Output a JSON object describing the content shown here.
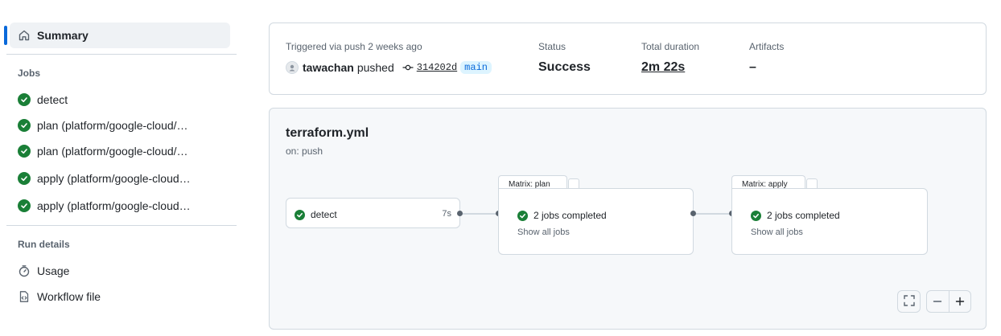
{
  "sidebar": {
    "summary_label": "Summary",
    "jobs_heading": "Jobs",
    "jobs": [
      {
        "label": "detect"
      },
      {
        "label": "plan (platform/google-cloud/…"
      },
      {
        "label": "plan (platform/google-cloud/…"
      },
      {
        "label": "apply (platform/google-cloud…"
      },
      {
        "label": "apply (platform/google-cloud…"
      }
    ],
    "run_details_heading": "Run details",
    "usage_label": "Usage",
    "workflow_file_label": "Workflow file"
  },
  "summary": {
    "trigger_text": "Triggered via push 2 weeks ago",
    "actor": "tawachan",
    "action": "pushed",
    "commit_sha": "314202d",
    "branch": "main",
    "status_label": "Status",
    "status_value": "Success",
    "duration_label": "Total duration",
    "duration_value": "2m 22s",
    "artifacts_label": "Artifacts",
    "artifacts_value": "–"
  },
  "workflow": {
    "title": "terraform.yml",
    "trigger": "on: push",
    "detect_job": {
      "name": "detect",
      "duration": "7s"
    },
    "plan_matrix": {
      "tab": "Matrix: plan",
      "summary": "2 jobs completed",
      "link": "Show all jobs"
    },
    "apply_matrix": {
      "tab": "Matrix: apply",
      "summary": "2 jobs completed",
      "link": "Show all jobs"
    }
  },
  "colors": {
    "success": "#1a7f37",
    "accent": "#0969da",
    "border": "#d1d9e0"
  },
  "icons": [
    "home-icon",
    "check-circle-icon",
    "stopwatch-icon",
    "file-code-icon",
    "git-commit-icon",
    "fullscreen-icon",
    "zoom-out-icon",
    "zoom-in-icon"
  ]
}
